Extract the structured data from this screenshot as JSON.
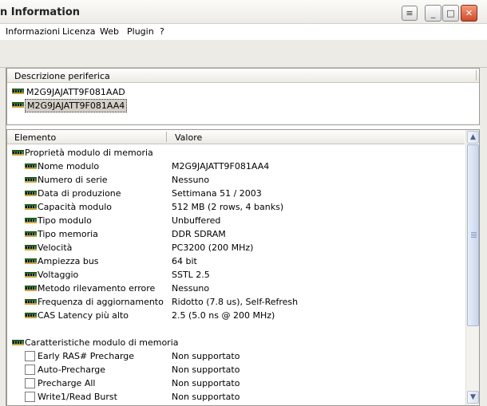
{
  "window": {
    "title": "n Information"
  },
  "menu": [
    "Informazioni",
    "Licenza",
    "Web",
    "Plugin",
    "?"
  ],
  "devices": {
    "header": "Descrizione periferica",
    "items": [
      "M2G9JAJATT9F081AAD",
      "M2G9JAJATT9F081AA4"
    ],
    "selected_index": 1
  },
  "details": {
    "col_element": "Elemento",
    "col_value": "Valore",
    "group1": {
      "title": "Proprietà modulo di memoria",
      "rows": [
        {
          "name": "Nome modulo",
          "value": "M2G9JAJATT9F081AA4"
        },
        {
          "name": "Numero di serie",
          "value": "Nessuno"
        },
        {
          "name": "Data di produzione",
          "value": "Settimana 51 / 2003"
        },
        {
          "name": "Capacità modulo",
          "value": "512 MB (2 rows, 4 banks)"
        },
        {
          "name": "Tipo modulo",
          "value": "Unbuffered"
        },
        {
          "name": "Tipo memoria",
          "value": "DDR SDRAM"
        },
        {
          "name": "Velocità",
          "value": "PC3200 (200 MHz)"
        },
        {
          "name": "Ampiezza bus",
          "value": "64 bit"
        },
        {
          "name": "Voltaggio",
          "value": "SSTL 2.5"
        },
        {
          "name": "Metodo rilevamento errore",
          "value": "Nessuno"
        },
        {
          "name": "Frequenza di aggiornamento",
          "value": "Ridotto (7.8 us), Self-Refresh"
        },
        {
          "name": "CAS Latency più alto",
          "value": "2.5 (5.0 ns @ 200 MHz)"
        }
      ]
    },
    "group2": {
      "title": "Caratteristiche modulo di memoria",
      "rows": [
        {
          "name": "Early RAS# Precharge",
          "value": "Non supportato"
        },
        {
          "name": "Auto-Precharge",
          "value": "Non supportato"
        },
        {
          "name": "Precharge All",
          "value": "Non supportato"
        },
        {
          "name": "Write1/Read Burst",
          "value": "Non supportato"
        }
      ]
    }
  },
  "icons": {
    "window_menu": "window-menu-icon",
    "minimize": "minimize-icon",
    "maximize": "maximize-icon",
    "close": "close-icon",
    "memory": "memory-module-icon",
    "checkbox": "checkbox-unchecked-icon"
  },
  "colors": {
    "memory_icon": "#2f6b2f",
    "close_button": "#d14a2a",
    "selection": "#d4d0c8"
  }
}
